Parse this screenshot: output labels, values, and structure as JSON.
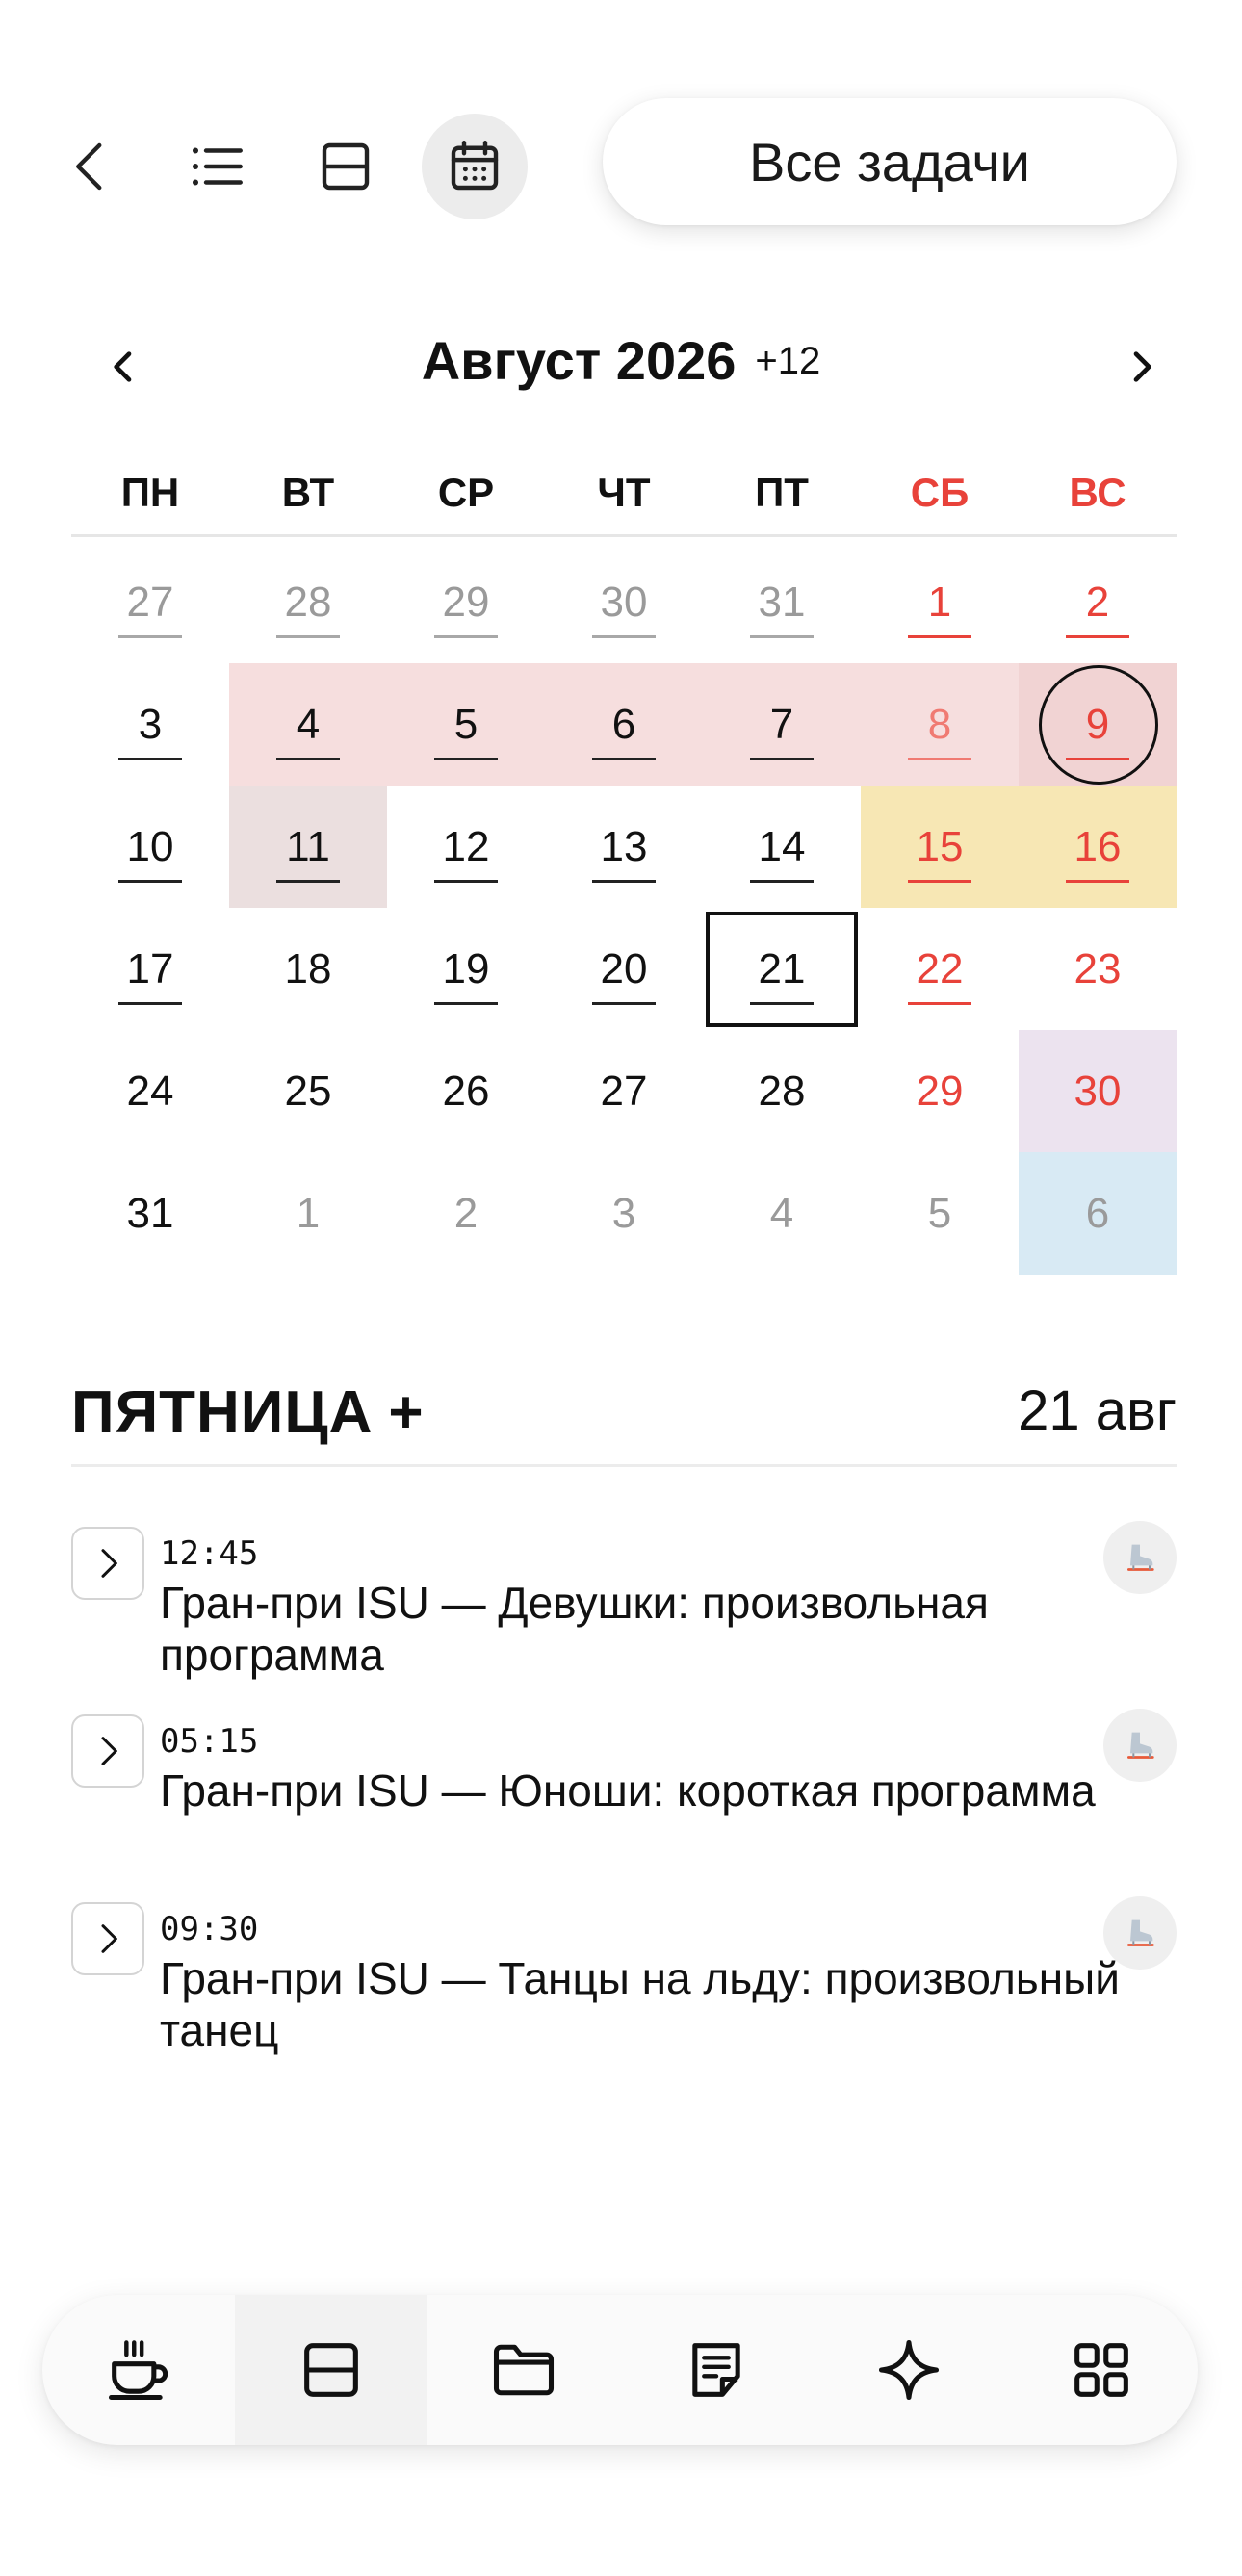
{
  "toolbar": {
    "back": "back",
    "list_view": "list",
    "split_view": "split",
    "calendar_view": "calendar",
    "all_tasks_label": "Все задачи"
  },
  "calendar": {
    "month_title": "Август 2026",
    "extra_count": "+12",
    "weekdays": [
      "ПН",
      "ВТ",
      "СР",
      "ЧТ",
      "ПТ",
      "СБ",
      "ВС"
    ],
    "weeks": [
      [
        "27",
        "28",
        "29",
        "30",
        "31",
        "1",
        "2"
      ],
      [
        "3",
        "4",
        "5",
        "6",
        "7",
        "8",
        "9"
      ],
      [
        "10",
        "11",
        "12",
        "13",
        "14",
        "15",
        "16"
      ],
      [
        "17",
        "18",
        "19",
        "20",
        "21",
        "22",
        "23"
      ],
      [
        "24",
        "25",
        "26",
        "27",
        "28",
        "29",
        "30"
      ],
      [
        "31",
        "1",
        "2",
        "3",
        "4",
        "5",
        "6"
      ]
    ],
    "today": "21",
    "selected": "9"
  },
  "day": {
    "title": "ПЯТНИЦА",
    "add": "+",
    "date": "21 авг"
  },
  "tasks": [
    {
      "time": "12:45",
      "title": "Гран-при ISU — Девушки: произвольная программа",
      "icon": "ice-skate-icon"
    },
    {
      "time": "05:15",
      "title": "Гран-при ISU — Юноши: короткая программа",
      "icon": "ice-skate-icon"
    },
    {
      "time": "09:30",
      "title": "Гран-при ISU — Танцы на льду: произвольный танец",
      "icon": "ice-skate-icon"
    }
  ],
  "bottom_nav": [
    "coffee-icon",
    "split-view-icon",
    "folder-icon",
    "notes-icon",
    "sparkle-icon",
    "grid-icon"
  ],
  "colors": {
    "weekend": "#e8423a",
    "pink_event": "#f6dede",
    "yellow_event": "#f7e7b4",
    "lilac_event": "#ece3ef",
    "blue_event": "#d8eaf4"
  }
}
